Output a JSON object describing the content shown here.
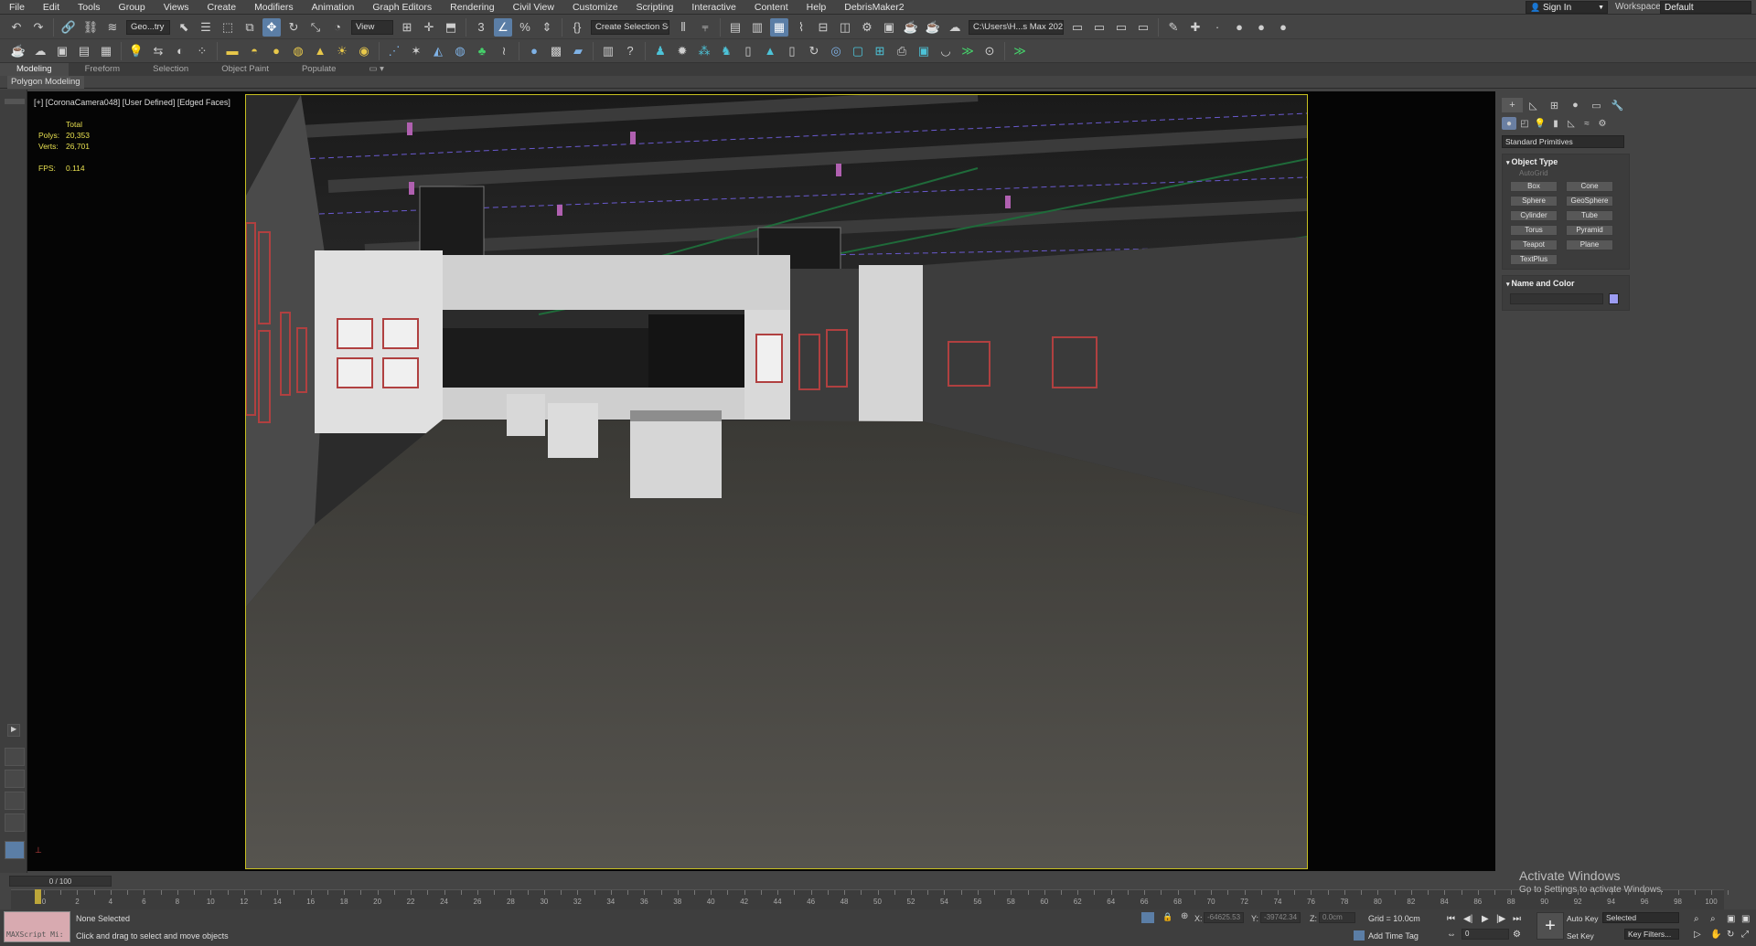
{
  "menu": [
    "File",
    "Edit",
    "Tools",
    "Group",
    "Views",
    "Create",
    "Modifiers",
    "Animation",
    "Graph Editors",
    "Rendering",
    "Civil View",
    "Customize",
    "Scripting",
    "Interactive",
    "Content",
    "Help",
    "DebrisMaker2"
  ],
  "account": {
    "sign_in": "Sign In",
    "workspaces_label": "Workspaces:",
    "workspace": "Default"
  },
  "toolbar": {
    "selection_filter": "Geo...try",
    "ref_coord": "View",
    "named_selection": "Create Selection Se",
    "project_path": "C:\\Users\\H...s Max 2020"
  },
  "ribbon": {
    "tabs": [
      "Modeling",
      "Freeform",
      "Selection",
      "Object Paint",
      "Populate"
    ],
    "active_panel": "Polygon Modeling"
  },
  "viewport": {
    "label": "[+] [CoronaCamera048] [User Defined] [Edged Faces]",
    "stats": {
      "header": "Total",
      "polys_label": "Polys:",
      "polys": "20,353",
      "verts_label": "Verts:",
      "verts": "26,701",
      "fps_label": "FPS:",
      "fps": "0.114"
    }
  },
  "command_panel": {
    "category": "Standard Primitives",
    "object_type_title": "Object Type",
    "autogrid": "AutoGrid",
    "buttons": [
      "Box",
      "Cone",
      "Sphere",
      "GeoSphere",
      "Cylinder",
      "Tube",
      "Torus",
      "Pyramid",
      "Teapot",
      "Plane",
      "TextPlus"
    ],
    "name_color_title": "Name and Color",
    "object_color": "#9c9cf2"
  },
  "timeline": {
    "frame": "0 / 100",
    "ticks": [
      "0",
      "2",
      "4",
      "6",
      "8",
      "10",
      "12",
      "14",
      "16",
      "18",
      "20",
      "22",
      "24",
      "26",
      "28",
      "30",
      "32",
      "34",
      "36",
      "38",
      "40",
      "42",
      "44",
      "46",
      "48",
      "50",
      "52",
      "54",
      "56",
      "58",
      "60",
      "62",
      "64",
      "66",
      "68",
      "70",
      "72",
      "74",
      "76",
      "78",
      "80",
      "82",
      "84",
      "86",
      "88",
      "90",
      "92",
      "94",
      "96",
      "98",
      "100"
    ]
  },
  "status": {
    "maxscript": "MAXScript Mi:",
    "selection": "None Selected",
    "hint": "Click and drag to select and move objects",
    "x_label": "X:",
    "x": "-64625.53",
    "y_label": "Y:",
    "y": "-39742.34",
    "z_label": "Z:",
    "z": "0.0cm",
    "grid": "Grid = 10.0cm",
    "add_time_tag": "Add Time Tag",
    "auto_key": "Auto Key",
    "set_key": "Set Key",
    "key_mode": "Selected",
    "key_filters": "Key Filters...",
    "frame_field": "0"
  },
  "watermark": {
    "line1": "Activate Windows",
    "line2": "Go to Settings to activate Windows."
  }
}
